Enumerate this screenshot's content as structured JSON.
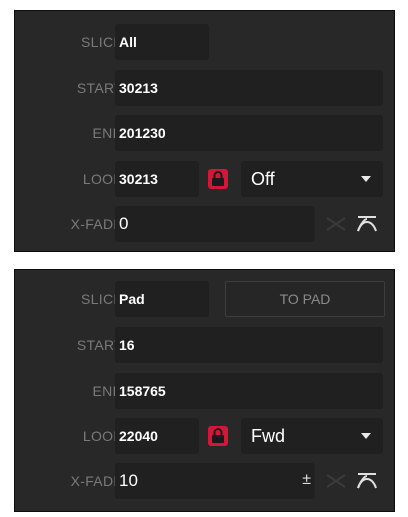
{
  "panel_all": {
    "slice": {
      "label": "SLICE",
      "value": "All"
    },
    "start": {
      "label": "START",
      "value": "30213"
    },
    "end": {
      "label": "END",
      "value": "201230"
    },
    "loop": {
      "label": "LOOP",
      "value": "30213",
      "mode": "Off"
    },
    "xfade": {
      "label": "X-FADE",
      "value": "0"
    }
  },
  "panel_pad": {
    "slice": {
      "label": "SLICE",
      "value": "Pad"
    },
    "to_pad_label": "TO PAD",
    "start": {
      "label": "START",
      "value": "16"
    },
    "end": {
      "label": "END",
      "value": "158765"
    },
    "loop": {
      "label": "LOOP",
      "value": "22040",
      "mode": "Fwd"
    },
    "xfade": {
      "label": "X-FADE",
      "value": "10",
      "adjust_symbol": "±"
    }
  },
  "colors": {
    "background": "#282828",
    "field": "#202020",
    "lock_accent": "#d4163a",
    "label": "#7a7a7a",
    "value": "#ffffff"
  },
  "icons": {
    "lock": "lock-icon",
    "dropdown": "chevron-down-icon",
    "crossfade_linear": "crossfade-linear-icon",
    "crossfade_curve": "crossfade-curve-icon"
  }
}
